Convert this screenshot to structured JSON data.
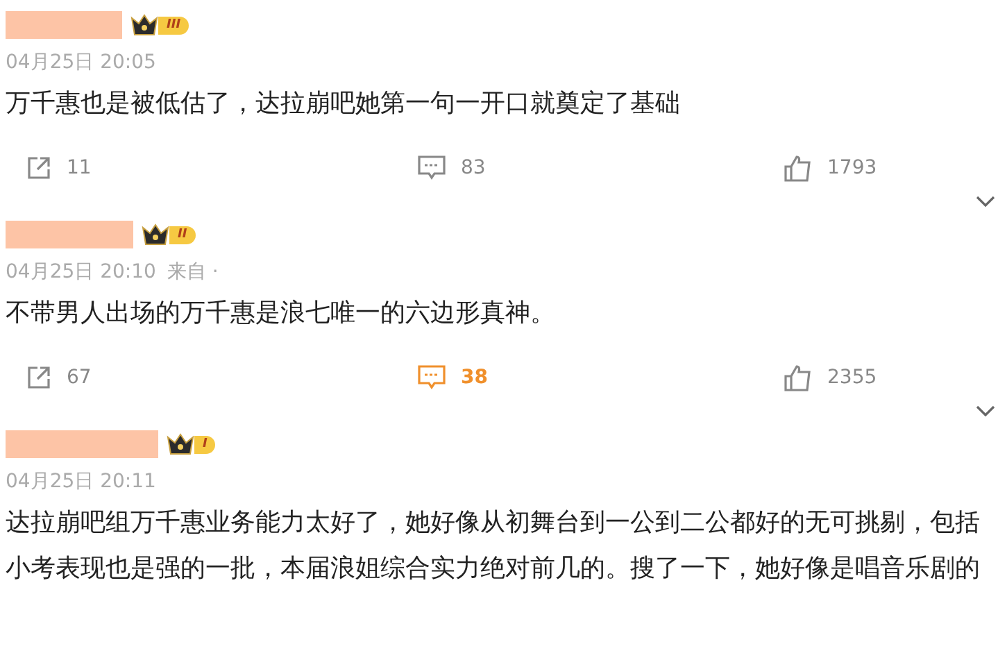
{
  "comments": [
    {
      "badge": "III",
      "time": "04月25日 20:05",
      "text": "万千惠也是被低估了，达拉崩吧她第一句一开口就奠定了基础",
      "shares": "11",
      "replies": "83",
      "replied": false,
      "likes": "1793",
      "more": true
    },
    {
      "badge": "II",
      "time": "04月25日 20:10",
      "source": "来自 ·",
      "text": "不带男人出场的万千惠是浪七唯一的六边形真神。",
      "shares": "67",
      "replies": "38",
      "replied": true,
      "likes": "2355",
      "more": true
    },
    {
      "badge": "I",
      "time": "04月25日 20:11",
      "text": "达拉崩吧组万千惠业务能力太好了，她好像从初舞台到一公到二公都好的无可挑剔，包括小考表现也是强的一批，本届浪姐综合实力绝对前几的。搜了一下，她好像是唱音乐剧的",
      "more": false
    }
  ]
}
